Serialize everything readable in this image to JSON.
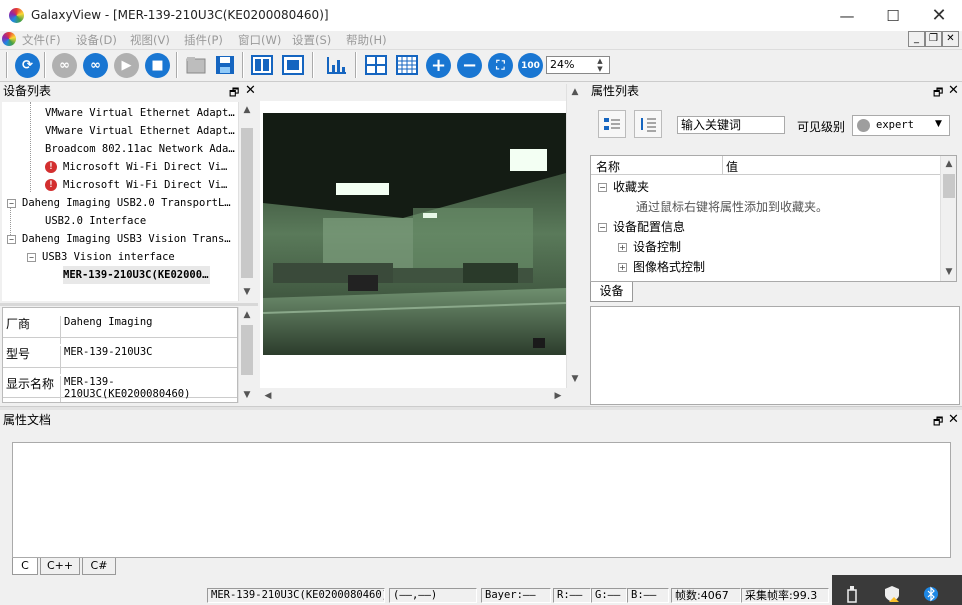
{
  "window": {
    "app_name": "GalaxyView",
    "title": "GalaxyView - [MER-139-210U3C(KE0200080460)]"
  },
  "menu": [
    "文件(F)",
    "设备(D)",
    "视图(V)",
    "插件(P)",
    "窗口(W)",
    "设置(S)",
    "帮助(H)"
  ],
  "toolbar": {
    "zoom_value": "24%",
    "zoom_100_label": "100"
  },
  "device_panel": {
    "title": "设备列表",
    "items": [
      "VMware Virtual Ethernet Adapt…",
      "VMware Virtual Ethernet Adapt…",
      "Broadcom 802.11ac Network Ada…",
      "Microsoft Wi-Fi Direct Vi…",
      "Microsoft Wi-Fi Direct Vi…",
      "Daheng Imaging USB2.0 TransportL…",
      "USB2.0 Interface",
      "Daheng Imaging USB3 Vision Trans…",
      "USB3 Vision interface",
      "MER-139-210U3C(KE02000…"
    ]
  },
  "device_info": {
    "rows": [
      {
        "key": "厂商",
        "value": "Daheng Imaging"
      },
      {
        "key": "型号",
        "value": "MER-139-210U3C"
      },
      {
        "key": "显示名称",
        "value": "MER-139-210U3C(KE0200080460)"
      }
    ]
  },
  "property_panel": {
    "title": "属性列表",
    "search_value": "输入关键词",
    "visibility_label": "可见级别",
    "visibility_value": "expert",
    "col_name": "名称",
    "col_value": "值",
    "rows": [
      "收藏夹",
      "通过鼠标右键将属性添加到收藏夹。",
      "设备配置信息",
      "设备控制",
      "图像格式控制"
    ],
    "tab": "设备"
  },
  "doc_panel": {
    "title": "属性文档",
    "tabs": [
      "C",
      "C++",
      "C#"
    ]
  },
  "status": {
    "device": "MER-139-210U3C(KE0200080460)",
    "coords": "(——,——)",
    "bayer": "Bayer:——",
    "r": "R:——",
    "g": "G:——",
    "b": "B:——",
    "frames": "帧数:4067",
    "fps": "采集帧率:99.3"
  }
}
